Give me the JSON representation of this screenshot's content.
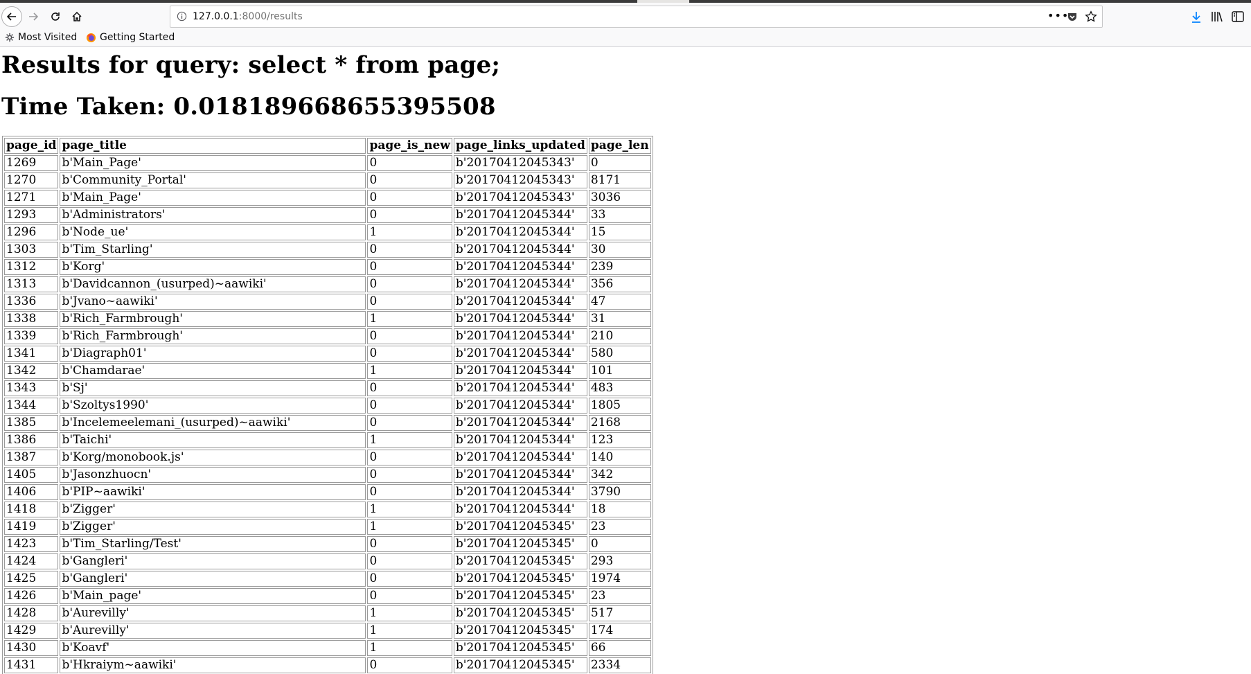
{
  "browser": {
    "url": "127.0.0.1:8000/results",
    "url_host": "127.0.0.1",
    "url_path": ":8000/results",
    "bookmarks": [
      "Most Visited",
      "Getting Started"
    ]
  },
  "page": {
    "heading_query": "Results for query: select * from page;",
    "heading_time": "Time Taken: 0.018189668655395508"
  },
  "table": {
    "columns": [
      "page_id",
      "page_title",
      "page_is_new",
      "page_links_updated",
      "page_len"
    ],
    "rows": [
      [
        "1269",
        "b'Main_Page'",
        "0",
        "b'20170412045343'",
        "0"
      ],
      [
        "1270",
        "b'Community_Portal'",
        "0",
        "b'20170412045343'",
        "8171"
      ],
      [
        "1271",
        "b'Main_Page'",
        "0",
        "b'20170412045343'",
        "3036"
      ],
      [
        "1293",
        "b'Administrators'",
        "0",
        "b'20170412045344'",
        "33"
      ],
      [
        "1296",
        "b'Node_ue'",
        "1",
        "b'20170412045344'",
        "15"
      ],
      [
        "1303",
        "b'Tim_Starling'",
        "0",
        "b'20170412045344'",
        "30"
      ],
      [
        "1312",
        "b'Korg'",
        "0",
        "b'20170412045344'",
        "239"
      ],
      [
        "1313",
        "b'Davidcannon_(usurped)~aawiki'",
        "0",
        "b'20170412045344'",
        "356"
      ],
      [
        "1336",
        "b'Jvano~aawiki'",
        "0",
        "b'20170412045344'",
        "47"
      ],
      [
        "1338",
        "b'Rich_Farmbrough'",
        "1",
        "b'20170412045344'",
        "31"
      ],
      [
        "1339",
        "b'Rich_Farmbrough'",
        "0",
        "b'20170412045344'",
        "210"
      ],
      [
        "1341",
        "b'Diagraph01'",
        "0",
        "b'20170412045344'",
        "580"
      ],
      [
        "1342",
        "b'Chamdarae'",
        "1",
        "b'20170412045344'",
        "101"
      ],
      [
        "1343",
        "b'Sj'",
        "0",
        "b'20170412045344'",
        "483"
      ],
      [
        "1344",
        "b'Szoltys1990'",
        "0",
        "b'20170412045344'",
        "1805"
      ],
      [
        "1385",
        "b'Incelemeelemani_(usurped)~aawiki'",
        "0",
        "b'20170412045344'",
        "2168"
      ],
      [
        "1386",
        "b'Taichi'",
        "1",
        "b'20170412045344'",
        "123"
      ],
      [
        "1387",
        "b'Korg/monobook.js'",
        "0",
        "b'20170412045344'",
        "140"
      ],
      [
        "1405",
        "b'Jasonzhuocn'",
        "0",
        "b'20170412045344'",
        "342"
      ],
      [
        "1406",
        "b'PIP~aawiki'",
        "0",
        "b'20170412045344'",
        "3790"
      ],
      [
        "1418",
        "b'Zigger'",
        "1",
        "b'20170412045344'",
        "18"
      ],
      [
        "1419",
        "b'Zigger'",
        "1",
        "b'20170412045345'",
        "23"
      ],
      [
        "1423",
        "b'Tim_Starling/Test'",
        "0",
        "b'20170412045345'",
        "0"
      ],
      [
        "1424",
        "b'Gangleri'",
        "0",
        "b'20170412045345'",
        "293"
      ],
      [
        "1425",
        "b'Gangleri'",
        "0",
        "b'20170412045345'",
        "1974"
      ],
      [
        "1426",
        "b'Main_page'",
        "0",
        "b'20170412045345'",
        "23"
      ],
      [
        "1428",
        "b'Aurevilly'",
        "1",
        "b'20170412045345'",
        "517"
      ],
      [
        "1429",
        "b'Aurevilly'",
        "1",
        "b'20170412045345'",
        "174"
      ],
      [
        "1430",
        "b'Koavf'",
        "1",
        "b'20170412045345'",
        "66"
      ],
      [
        "1431",
        "b'Hkraiym~aawiki'",
        "0",
        "b'20170412045345'",
        "2334"
      ]
    ]
  }
}
